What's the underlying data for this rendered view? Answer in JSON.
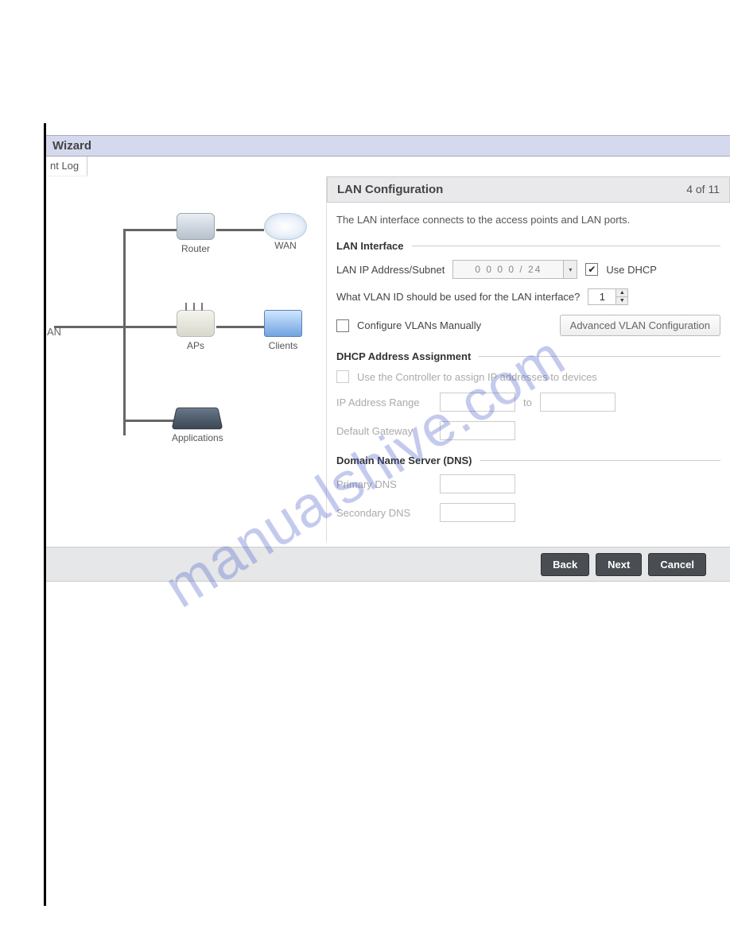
{
  "header": {
    "wizard_title": "Wizard",
    "tab_label": "nt Log"
  },
  "diagram": {
    "lan_label": "AN",
    "router": "Router",
    "wan": "WAN",
    "aps": "APs",
    "clients": "Clients",
    "applications": "Applications"
  },
  "panel": {
    "title": "LAN Configuration",
    "step": "4 of 11",
    "intro": "The LAN interface connects to the access points and LAN ports."
  },
  "lan_if": {
    "section": "LAN Interface",
    "ip_label": "LAN IP Address/Subnet",
    "ip_value": "0   0   0   0 / 24",
    "use_dhcp_label": "Use DHCP",
    "use_dhcp_checked": "✔",
    "vlan_q": "What VLAN ID should be used for the LAN interface?",
    "vlan_value": "1",
    "cfg_manual": "Configure VLANs Manually",
    "adv_btn": "Advanced VLAN Configuration"
  },
  "dhcp": {
    "section": "DHCP Address Assignment",
    "use_ctrl": "Use the Controller to assign IP addresses to devices",
    "range_label": "IP Address Range",
    "to": "to",
    "gateway_label": "Default Gateway"
  },
  "dns": {
    "section": "Domain Name Server (DNS)",
    "primary": "Primary DNS",
    "secondary": "Secondary DNS"
  },
  "footer": {
    "back": "Back",
    "next": "Next",
    "cancel": "Cancel"
  },
  "watermark": "manualshive.com"
}
